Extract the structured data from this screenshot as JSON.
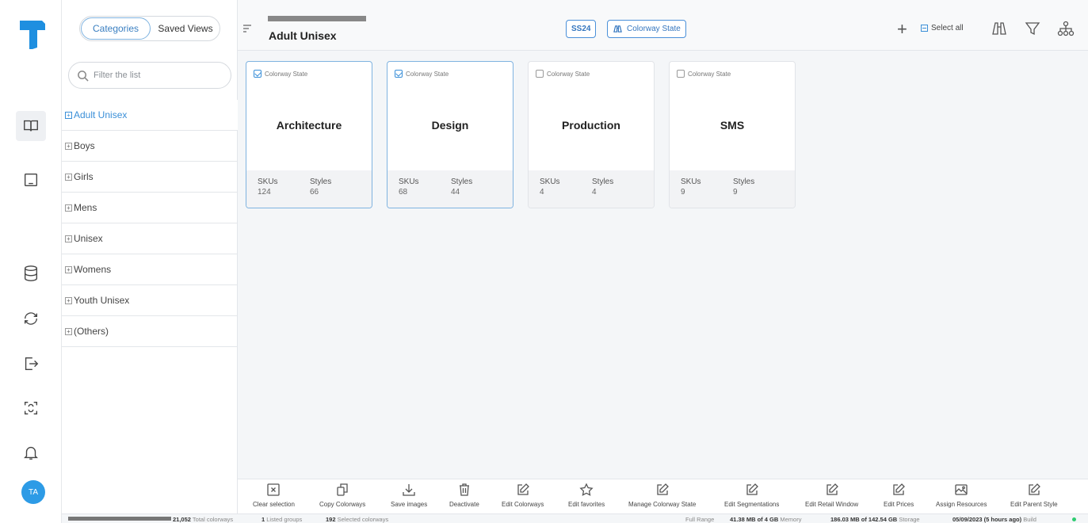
{
  "rail": {
    "avatar_initials": "TA",
    "icons": [
      "book-icon",
      "laptop-icon",
      "database-icon",
      "sync-icon",
      "export-icon",
      "scan-icon",
      "bell-icon"
    ]
  },
  "panel": {
    "tabs": [
      "Categories",
      "Saved Views"
    ],
    "filter_placeholder": "Filter the list",
    "categories": [
      "Adult Unisex",
      "Boys",
      "Girls",
      "Mens",
      "Unisex",
      "Womens",
      "Youth Unisex",
      "(Others)"
    ]
  },
  "header": {
    "title": "Adult Unisex",
    "season_pill": "SS24",
    "state_pill": "Colorway State",
    "select_all": "Select all"
  },
  "cards": [
    {
      "state_label": "Colorway State",
      "name": "Architecture",
      "skus_label": "SKUs",
      "skus": "124",
      "styles_label": "Styles",
      "styles": "66",
      "selected": true
    },
    {
      "state_label": "Colorway State",
      "name": "Design",
      "skus_label": "SKUs",
      "skus": "68",
      "styles_label": "Styles",
      "styles": "44",
      "selected": true
    },
    {
      "state_label": "Colorway State",
      "name": "Production",
      "skus_label": "SKUs",
      "skus": "4",
      "styles_label": "Styles",
      "styles": "4",
      "selected": false
    },
    {
      "state_label": "Colorway State",
      "name": "SMS",
      "skus_label": "SKUs",
      "skus": "9",
      "styles_label": "Styles",
      "styles": "9",
      "selected": false
    }
  ],
  "actions": [
    "Clear selection",
    "Copy Colorways",
    "Save images",
    "Deactivate",
    "Edit Colorways",
    "Edit favorites",
    "Manage Colorway State",
    "Edit Segmentations",
    "Edit Retail Window",
    "Edit Prices",
    "Assign Resources",
    "Edit Parent Style"
  ],
  "status": {
    "total_colorways_value": "21,052",
    "total_colorways_label": "Total colorways",
    "listed_groups_value": "1",
    "listed_groups_label": "Listed groups",
    "selected_colorways_value": "192",
    "selected_colorways_label": "Selected colorways",
    "range_label": "Full Range",
    "memory_value": "41.38 MB of 4 GB",
    "memory_label": "Memory",
    "storage_value": "186.03 MB of 142.54 GB",
    "storage_label": "Storage",
    "build_value": "05/09/2023 (5 hours ago)",
    "build_label": "Build"
  },
  "colors": {
    "accent": "#3a8fd8",
    "status_ok": "#2ecc71"
  }
}
